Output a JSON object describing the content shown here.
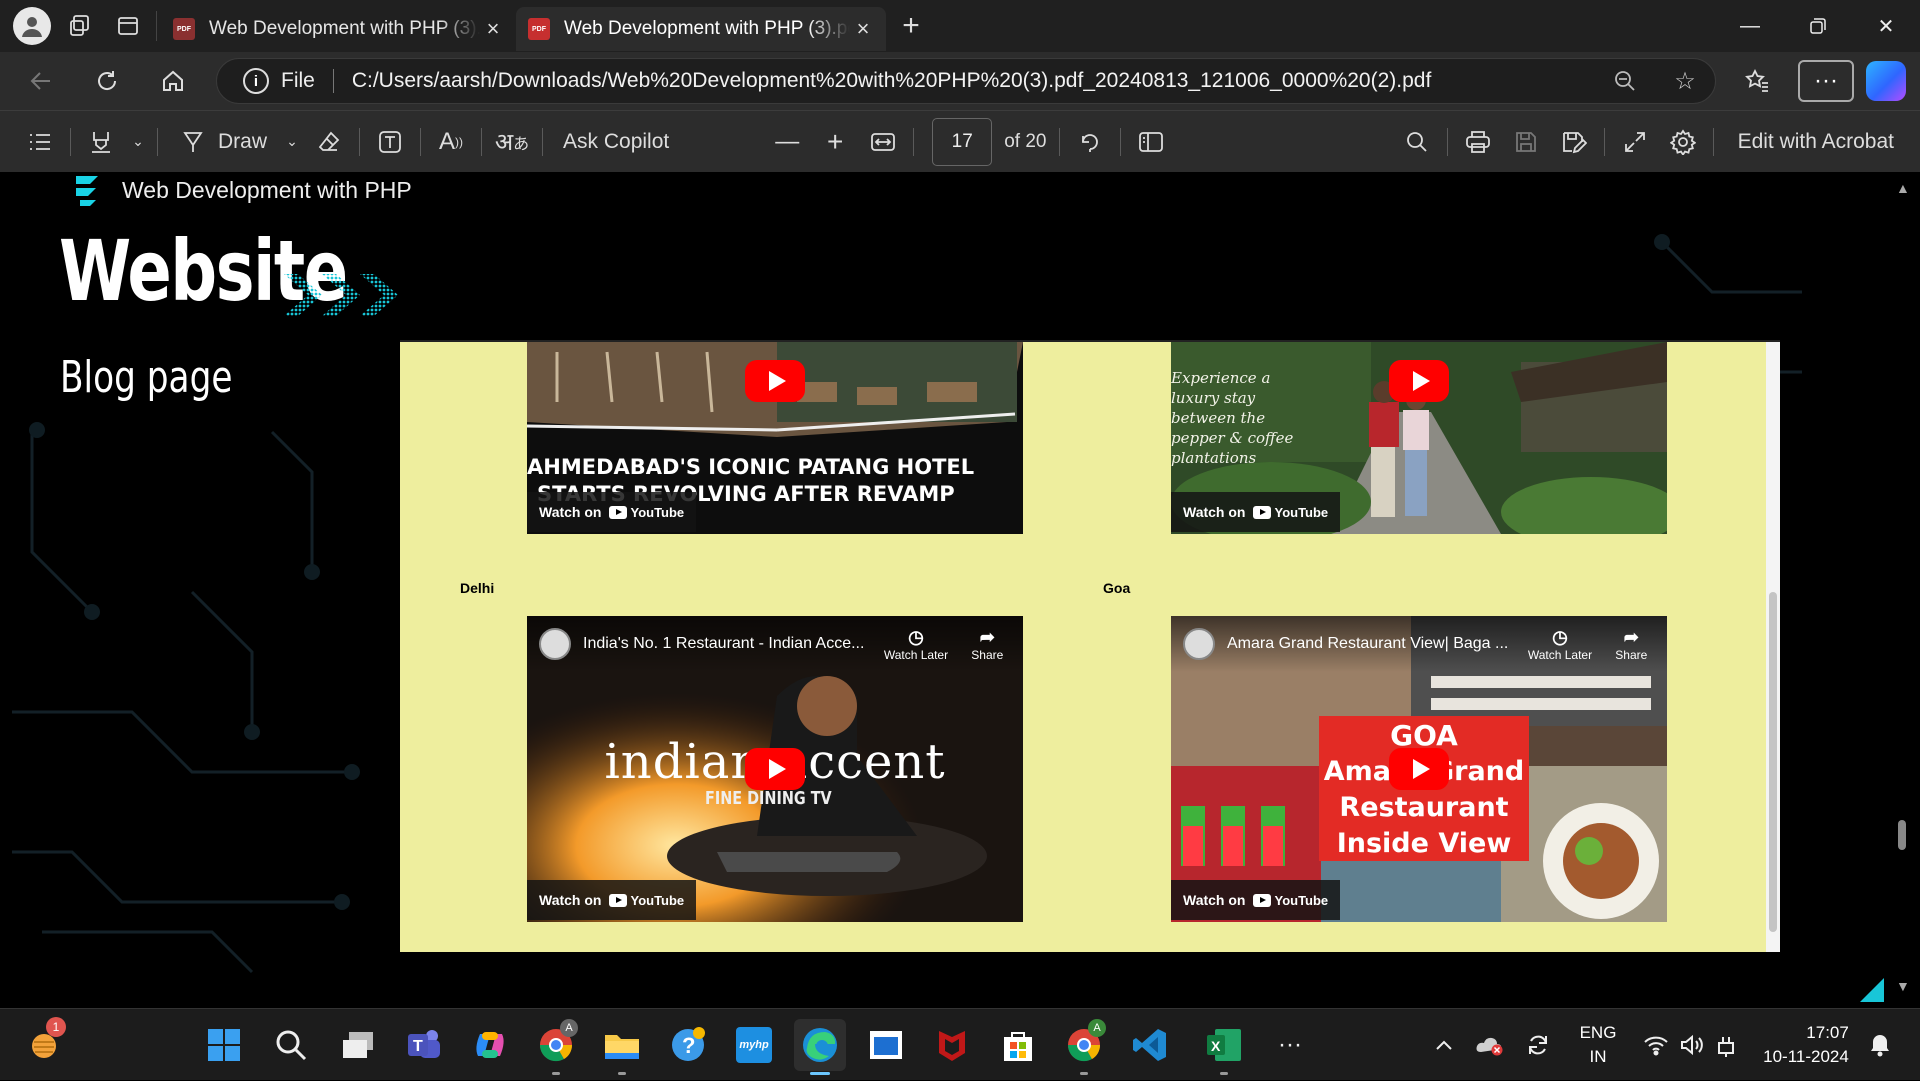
{
  "browser": {
    "tabs": [
      {
        "label": "Web Development with PHP (3).pdf",
        "active": false
      },
      {
        "label": "Web Development with PHP (3).pdf",
        "active": true
      }
    ],
    "address": {
      "scheme_label": "File",
      "url": "C:/Users/aarsh/Downloads/Web%20Development%20with%20PHP%20(3).pdf_20240813_121006_0000%20(2).pdf"
    }
  },
  "pdf_toolbar": {
    "draw_label": "Draw",
    "ask_copilot_label": "Ask Copilot",
    "page_current": "17",
    "page_total": "of 20",
    "edit_acrobat_label": "Edit with Acrobat"
  },
  "page": {
    "header_text": "Web Development with PHP",
    "title": "Website",
    "subtitle": "Blog page",
    "embed": {
      "city_left": "Delhi",
      "city_right": "Goa",
      "videos": {
        "top_left": {
          "overlay_line1": "AHMEDABAD'S ICONIC PATANG HOTEL",
          "overlay_line2": "STARTS REVOLVING AFTER REVAMP",
          "watch_on": "Watch on",
          "yt": "YouTube"
        },
        "top_right": {
          "script_text": "Experience a luxury stay between the pepper & coffee plantations",
          "watch_on": "Watch on",
          "yt": "YouTube"
        },
        "bottom_left": {
          "title": "India's No. 1 Restaurant - Indian Acce...",
          "watch_later": "Watch Later",
          "share": "Share",
          "overlay_big": "indian accent",
          "overlay_small": "FINE DINING TV",
          "watch_on": "Watch on",
          "yt": "YouTube"
        },
        "bottom_right": {
          "title": "Amara Grand Restaurant View| Baga ...",
          "watch_later": "Watch Later",
          "share": "Share",
          "overlay_l1": "GOA",
          "overlay_l2": "Amara Grand",
          "overlay_l3": "Restaurant",
          "overlay_l4": "Inside View",
          "watch_on": "Watch on",
          "yt": "YouTube"
        }
      }
    }
  },
  "taskbar": {
    "badge_count": "1",
    "lang_line1": "ENG",
    "lang_line2": "IN",
    "time": "17:07",
    "date": "10-11-2024"
  },
  "colors": {
    "embed_bg": "#eeee9e",
    "youtube_red": "#ff0000",
    "accent_cyan": "#18d0e0"
  }
}
